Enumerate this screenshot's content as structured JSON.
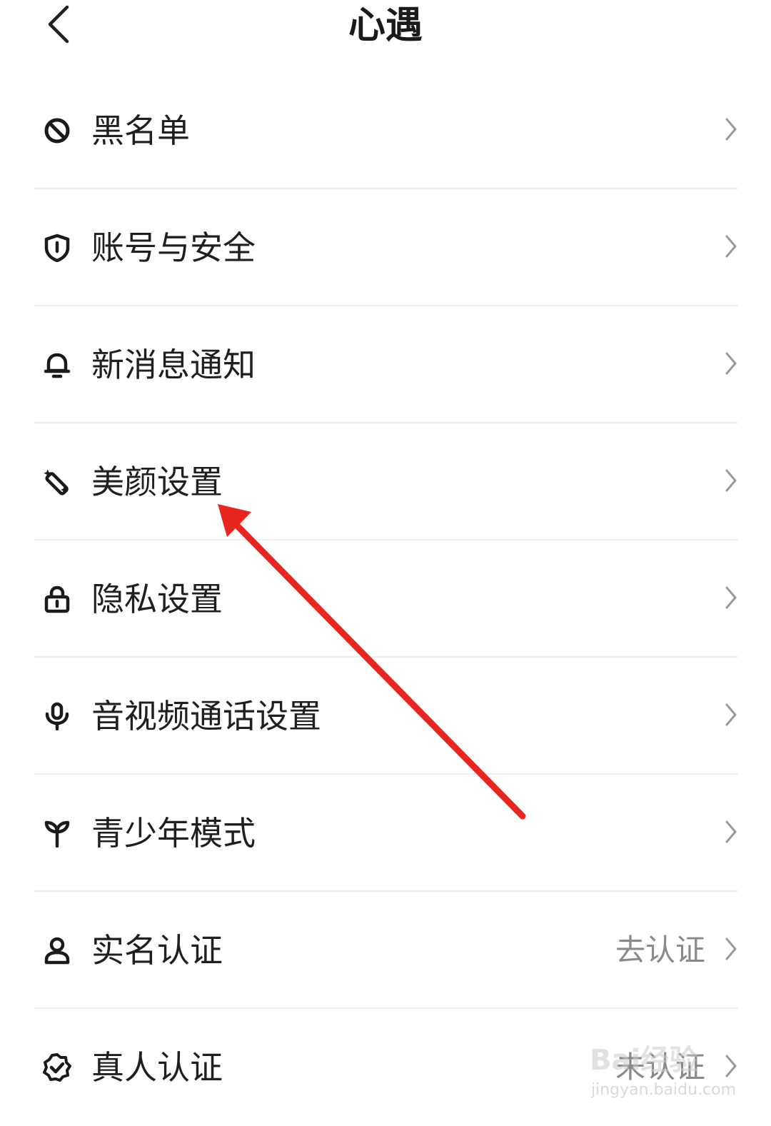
{
  "header": {
    "title": "心遇",
    "back_icon": "chevron-left-icon"
  },
  "settings": {
    "items": [
      {
        "label": "黑名单",
        "icon": "block-icon",
        "value": ""
      },
      {
        "label": "账号与安全",
        "icon": "shield-icon",
        "value": ""
      },
      {
        "label": "新消息通知",
        "icon": "bell-icon",
        "value": ""
      },
      {
        "label": "美颜设置",
        "icon": "beauty-wand-icon",
        "value": ""
      },
      {
        "label": "隐私设置",
        "icon": "lock-icon",
        "value": ""
      },
      {
        "label": "音视频通话设置",
        "icon": "microphone-icon",
        "value": ""
      },
      {
        "label": "青少年模式",
        "icon": "sprout-icon",
        "value": ""
      },
      {
        "label": "实名认证",
        "icon": "person-icon",
        "value": "去认证"
      },
      {
        "label": "真人认证",
        "icon": "verified-badge-icon",
        "value": "未认证"
      }
    ]
  },
  "annotation": {
    "arrow_color": "#e8251f"
  },
  "watermark": {
    "text": "Bai经验",
    "sub": "jingyan.baidu.com"
  }
}
